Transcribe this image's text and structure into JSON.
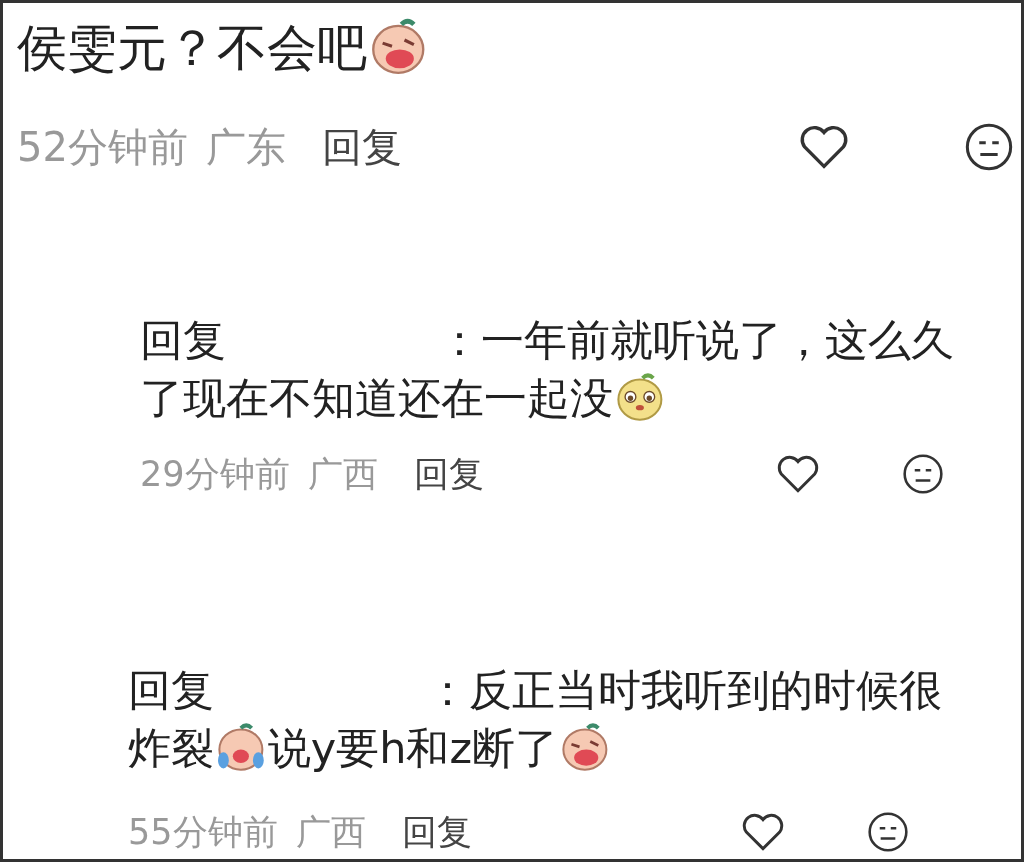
{
  "comments": [
    {
      "kind": "comment",
      "parts": [
        {
          "kind": "text",
          "text": "侯雯元？不会吧"
        },
        {
          "kind": "crying-emoji"
        }
      ],
      "time": "52分钟前",
      "location": "广东",
      "reply_button": "回复"
    },
    {
      "kind": "reply",
      "reply_label": "回复",
      "parts": [
        {
          "kind": "text",
          "text": "：一年前就听说了，这么久了现在不知道还在一起没"
        },
        {
          "kind": "smirk-emoji"
        }
      ],
      "time": "29分钟前",
      "location": "广西",
      "reply_button": "回复"
    },
    {
      "kind": "reply",
      "reply_label": "回复",
      "parts": [
        {
          "kind": "text",
          "text": "：反正当时我听到的时候很炸裂"
        },
        {
          "kind": "tears-emoji"
        },
        {
          "kind": "text",
          "text": "说y要h和z断了"
        },
        {
          "kind": "crying-emoji"
        }
      ],
      "time": "55分钟前",
      "location": "广西",
      "reply_button": "回复"
    }
  ]
}
